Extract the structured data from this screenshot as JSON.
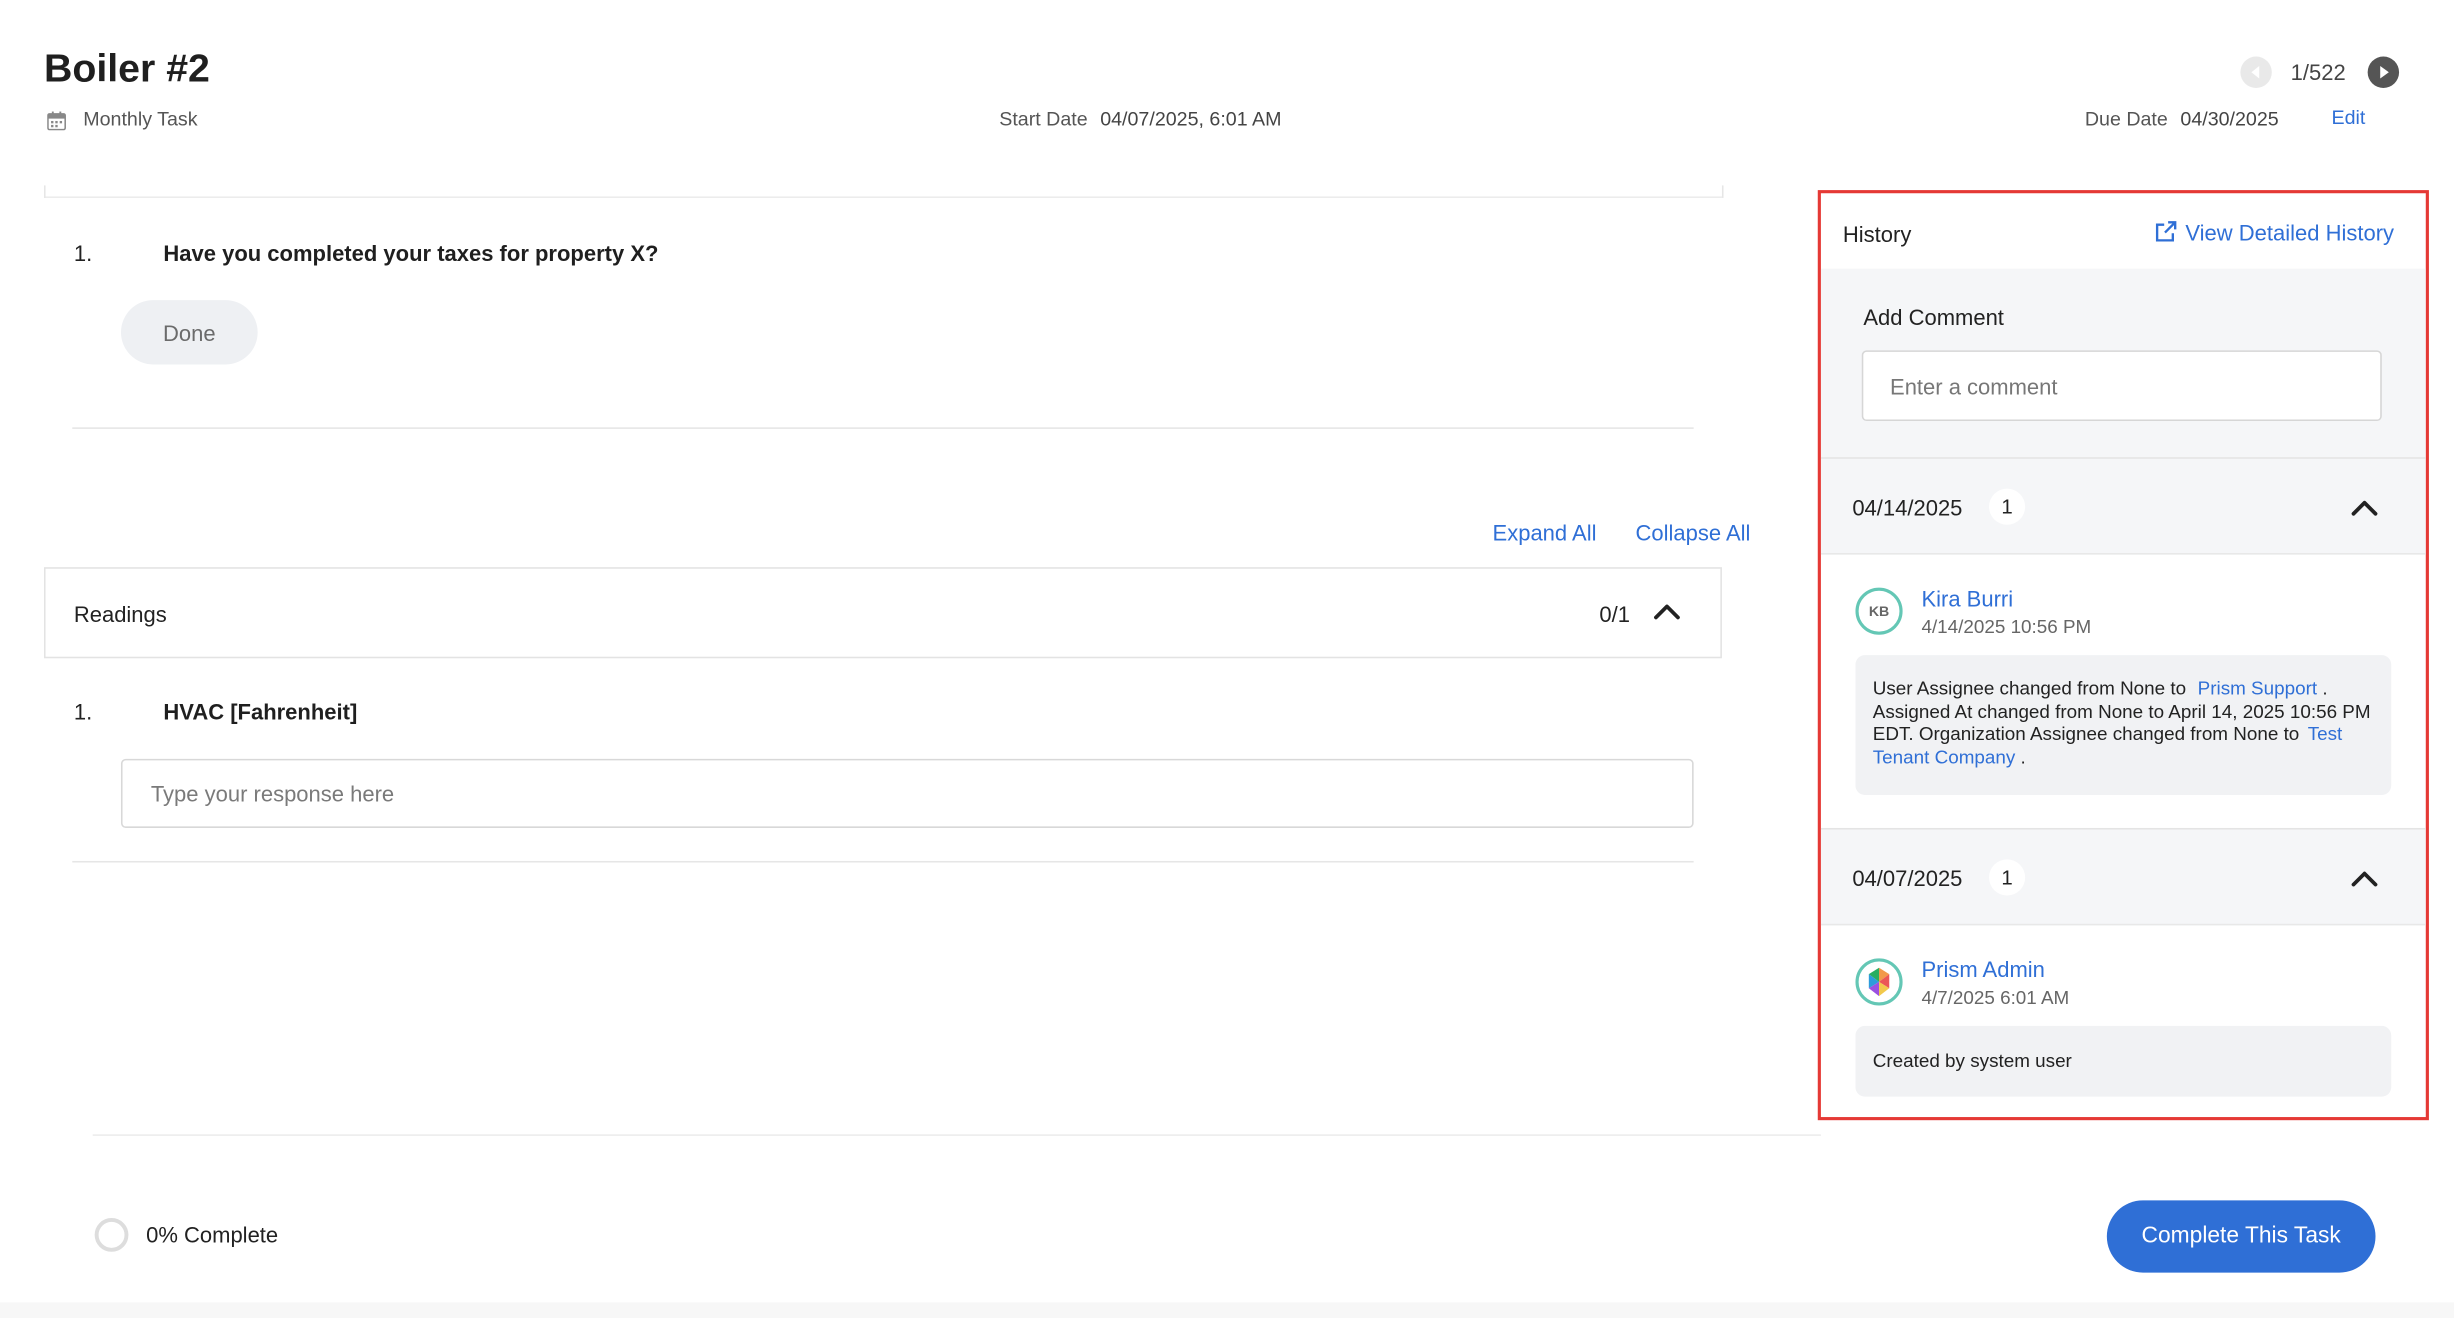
{
  "header": {
    "title": "Boiler #2",
    "task_type": "Monthly Task",
    "start_date_label": "Start Date",
    "start_date_value": "04/07/2025, 6:01 AM",
    "due_date_label": "Due Date",
    "due_date_value": "04/30/2025",
    "edit_label": "Edit",
    "pager": "1/522"
  },
  "question1": {
    "number": "1.",
    "text": "Have you completed your taxes for property X?",
    "done_label": "Done"
  },
  "controls": {
    "expand_all": "Expand All",
    "collapse_all": "Collapse All"
  },
  "readings": {
    "title": "Readings",
    "count": "0/1",
    "item_number": "1.",
    "item_label": "HVAC [Fahrenheit]",
    "response_placeholder": "Type your response here"
  },
  "history": {
    "title": "History",
    "detail_link": "View Detailed History",
    "add_comment_label": "Add Comment",
    "comment_placeholder": "Enter a comment",
    "groups": [
      {
        "date": "04/14/2025",
        "count": "1",
        "user_initials": "KB",
        "user_name": "Kira Burri",
        "time": "4/14/2025 10:56 PM",
        "msg_a": "User Assignee changed from None to",
        "msg_link1": "Prism Support",
        "msg_dot1": ".",
        "msg_b": "Assigned At changed from None to April 14, 2025 10:56 PM EDT. Organization Assignee changed from None to",
        "msg_link2": "Test Tenant Company",
        "msg_dot2": "."
      },
      {
        "date": "04/07/2025",
        "count": "1",
        "user_name": "Prism Admin",
        "time": "4/7/2025 6:01 AM",
        "message": "Created by system user"
      }
    ]
  },
  "footer": {
    "progress_label": "0% Complete",
    "progress_value": 0,
    "complete_button": "Complete This Task"
  },
  "colors": {
    "accent": "#2f6fd6",
    "highlight_border": "#e53935",
    "avatar_ring": "#64c7b5"
  }
}
